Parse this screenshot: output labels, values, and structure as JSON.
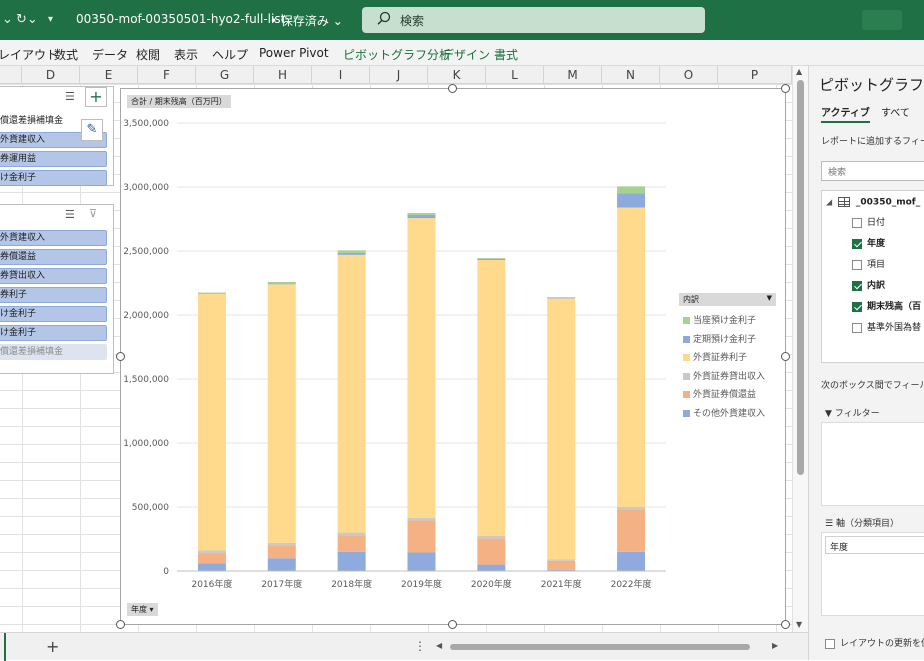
{
  "titlebar": {
    "filename": "00350-mof-00350501-hyo2-full-list···",
    "save_status": "• 保存済み ⌄",
    "search_placeholder": "検索"
  },
  "ribbon": {
    "tabs": [
      "レイアウト",
      "数式",
      "データ",
      "校閲",
      "表示",
      "ヘルプ",
      "Power Pivot"
    ],
    "context_tabs": [
      "ピボットグラフ分析",
      "デザイン",
      "書式"
    ]
  },
  "columns": [
    "D",
    "E",
    "F",
    "G",
    "H",
    "I",
    "J",
    "K",
    "L",
    "M",
    "N",
    "O",
    "P"
  ],
  "slicer1": {
    "items": [
      {
        "label": "償還差損補填金",
        "state": "plain"
      },
      {
        "label": "外貨建収入",
        "state": "selected"
      },
      {
        "label": "券運用益",
        "state": "selected"
      },
      {
        "label": "け金利子",
        "state": "selected"
      }
    ]
  },
  "slicer2": {
    "items": [
      {
        "label": "外貨建収入",
        "state": "selected"
      },
      {
        "label": "券償還益",
        "state": "selected"
      },
      {
        "label": "券貸出収入",
        "state": "selected"
      },
      {
        "label": "券利子",
        "state": "selected"
      },
      {
        "label": "け金利子",
        "state": "selected"
      },
      {
        "label": "け金利子",
        "state": "selected"
      },
      {
        "label": "償還差損補填金",
        "state": "dim"
      }
    ]
  },
  "chart": {
    "value_button": "合計 / 期末残高（百万円）",
    "axis_button": "年度 ▾",
    "legend_title": "内訳"
  },
  "chart_data": {
    "type": "bar",
    "stacked": true,
    "categories": [
      "2016年度",
      "2017年度",
      "2018年度",
      "2019年度",
      "2020年度",
      "2021年度",
      "2022年度"
    ],
    "series": [
      {
        "name": "その他外貨建収入",
        "color": "#8faadc",
        "values": [
          60000,
          100000,
          150000,
          145000,
          50000,
          10000,
          150000
        ]
      },
      {
        "name": "外貨証券償還益",
        "color": "#f4b183",
        "values": [
          80000,
          100000,
          130000,
          250000,
          205000,
          70000,
          330000
        ]
      },
      {
        "name": "外貨証券貸出収入",
        "color": "#c9c9c9",
        "values": [
          20000,
          20000,
          20000,
          20000,
          20000,
          10000,
          20000
        ]
      },
      {
        "name": "外貨証券利子",
        "color": "#ffd98c",
        "values": [
          2005000,
          2020000,
          2170000,
          2342000,
          2155000,
          2040000,
          2340000
        ]
      },
      {
        "name": "定期預け金利子",
        "color": "#8ea9db",
        "values": [
          5000,
          8000,
          15000,
          25000,
          10000,
          5000,
          110000
        ]
      },
      {
        "name": "当座預け金利子",
        "color": "#a9d18e",
        "values": [
          5000,
          10000,
          20000,
          15000,
          5000,
          5000,
          55000
        ]
      }
    ],
    "ylim": [
      0,
      3500000
    ],
    "yticks": [
      "0",
      "500,000",
      "1,000,000",
      "1,500,000",
      "2,000,000",
      "2,500,000",
      "3,000,000",
      "3,500,000"
    ],
    "grid": true,
    "legend": "right"
  },
  "panel": {
    "title": "ピボットグラフの",
    "tab_active": "アクティブ",
    "tab_all": "すべて",
    "hint": "レポートに追加するフィール",
    "search_placeholder": "検索",
    "table_name": "_00350_mof_",
    "fields": [
      {
        "label": "日付",
        "checked": false
      },
      {
        "label": "年度",
        "checked": true
      },
      {
        "label": "項目",
        "checked": false
      },
      {
        "label": "内訳",
        "checked": true
      },
      {
        "label": "期末残高（百",
        "checked": true
      },
      {
        "label": "基準外国為替",
        "checked": false
      }
    ],
    "hint2": "次のボックス間でフィールド",
    "filter_label": "フィルター",
    "axis_label": "軸（分類項目）",
    "axis_field": "年度",
    "defer_label": "レイアウトの更新を保"
  }
}
